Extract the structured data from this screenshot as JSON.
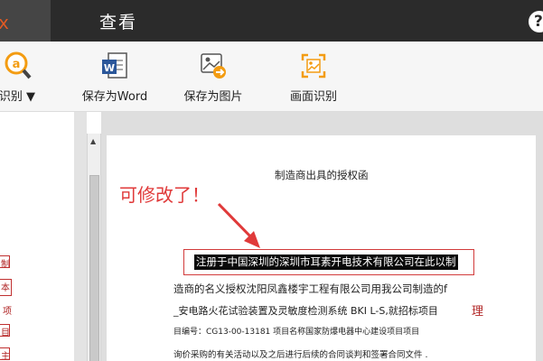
{
  "tabs": {
    "active_label": "ｘ",
    "view_label": "查看"
  },
  "help_label": "?",
  "toolbar": {
    "items": [
      {
        "label": "识别 ▼"
      },
      {
        "label": "保存为Word"
      },
      {
        "label": "保存为图片"
      },
      {
        "label": "画面识别"
      }
    ],
    "colors": {
      "accent": "#f39c12",
      "word_blue": "#2b579a"
    }
  },
  "left_margin_chars": [
    "制",
    "本",
    "项",
    "目",
    "主"
  ],
  "document": {
    "title": "制造商出具的授权函",
    "annotation": "可修改了！",
    "highlighted_line": "注册于中国深圳的深圳市耳素开电技术有限公司在此以制",
    "line2": "造商的名义授权沈阳凤鑫楼宇工程有限公司用我公司制造的f",
    "line3": "_安电路火花试验装置及灵敏度检测系统 BKI L-S,就招标项目",
    "line3_tail": "理",
    "line4": "目编号：CG13-00-13181  项目名称国家防爆电器中心建设项目项目",
    "line5": "询价采购的有关活动以及之后进行后续的合同谈判和签署合同文件 ."
  }
}
